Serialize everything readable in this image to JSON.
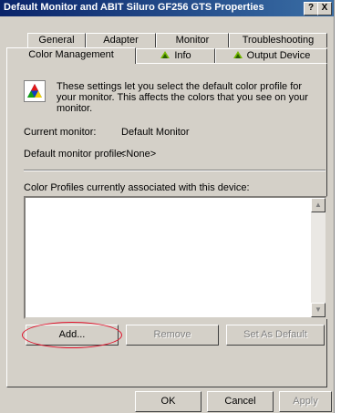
{
  "window": {
    "title": "Default Monitor and ABIT Siluro GF256 GTS Properties",
    "help_label": "?",
    "close_label": "X"
  },
  "tabs": {
    "row1": [
      "General",
      "Adapter",
      "Monitor",
      "Troubleshooting"
    ],
    "row2": [
      {
        "label": "Color Management",
        "active": true
      },
      {
        "label": "Info",
        "icon": "nvidia-icon"
      },
      {
        "label": "Output Device",
        "icon": "nvidia-icon"
      }
    ]
  },
  "content": {
    "info_text": "These settings let you select the default color profile for your monitor. This affects the colors that you see on your monitor.",
    "current_monitor_label": "Current monitor:",
    "current_monitor_value": "Default Monitor",
    "default_profile_label": "Default monitor profile:",
    "default_profile_value": "<None>",
    "profiles_label": "Color Profiles currently associated with this device:",
    "profiles": []
  },
  "buttons": {
    "add": "Add...",
    "remove": "Remove",
    "set_default": "Set As Default",
    "ok": "OK",
    "cancel": "Cancel",
    "apply": "Apply"
  },
  "colors": {
    "title_gradient_start": "#0a246a",
    "title_gradient_end": "#3a6ea5",
    "dialog_face": "#d4d0c8",
    "annotation_red": "#e0102a"
  }
}
